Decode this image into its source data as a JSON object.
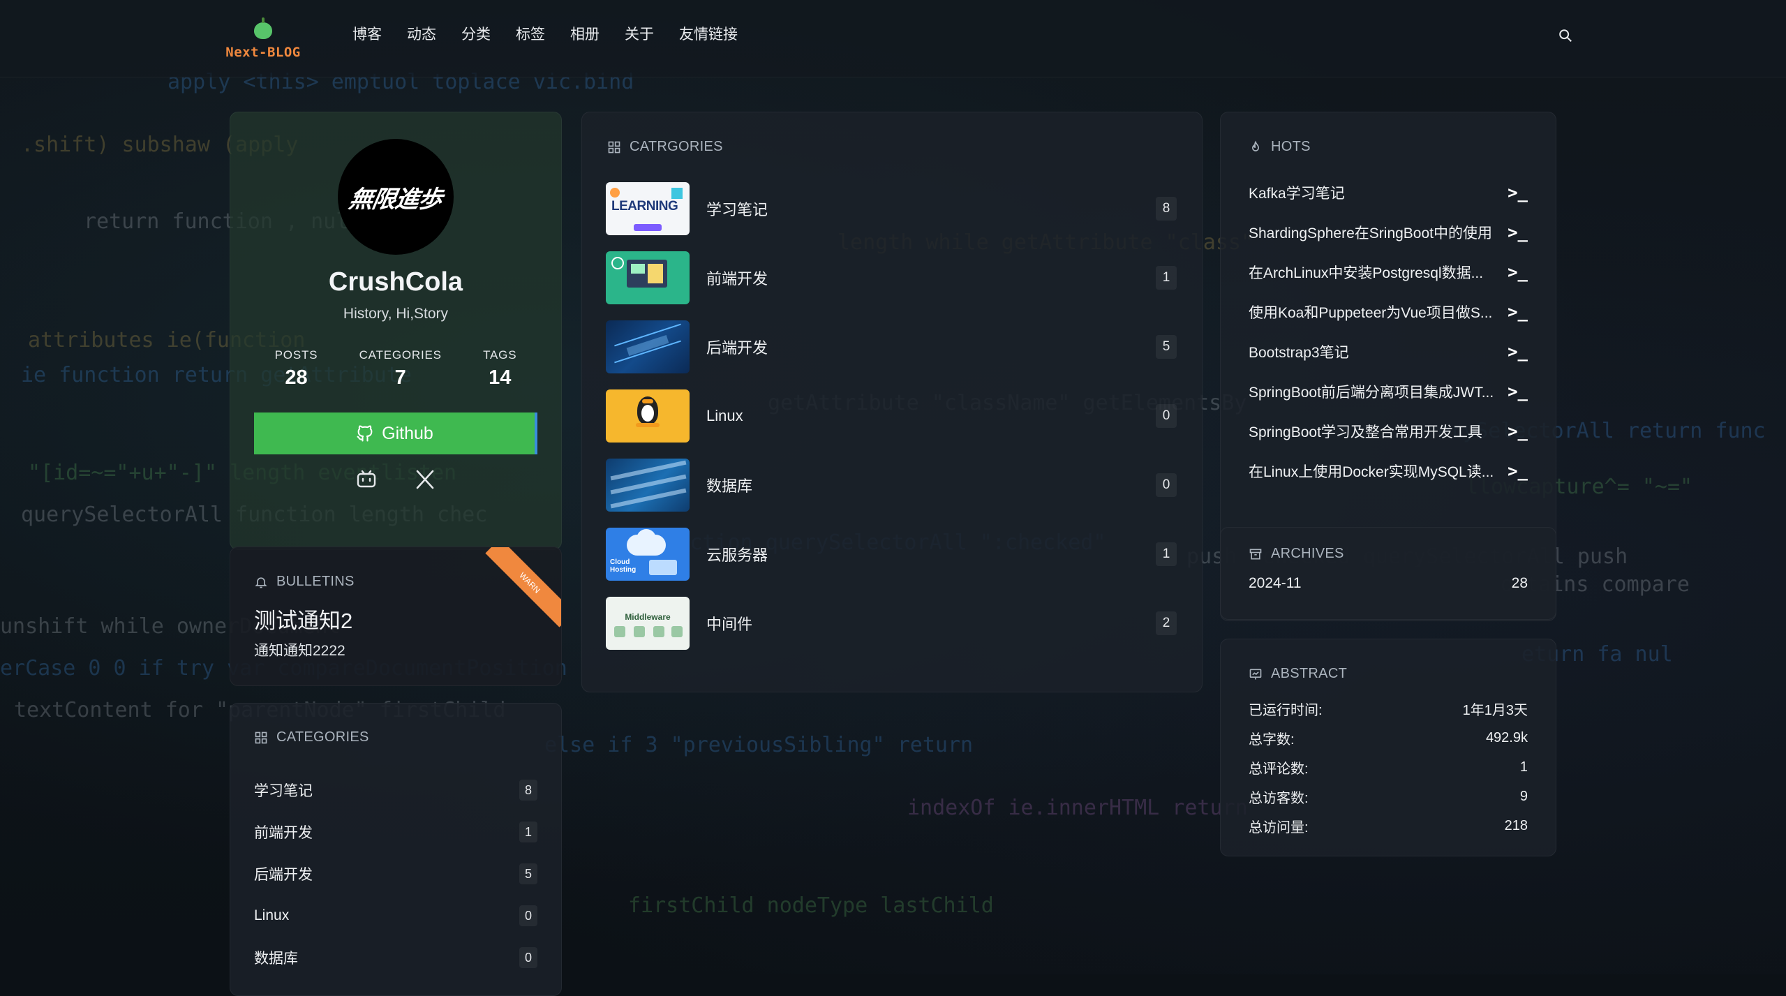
{
  "header": {
    "logo_text": "Next-BLOG",
    "nav": [
      "博客",
      "动态",
      "分类",
      "标签",
      "相册",
      "关于",
      "友情链接"
    ]
  },
  "profile": {
    "avatar_text": "無限進歩",
    "name": "CrushCola",
    "motto": "History, Hi,Story",
    "stats": [
      {
        "label": "POSTS",
        "value": "28"
      },
      {
        "label": "CATEGORIES",
        "value": "7"
      },
      {
        "label": "TAGS",
        "value": "14"
      }
    ],
    "github_label": "Github",
    "social_icons": [
      "bilibili-icon",
      "x-icon"
    ]
  },
  "bulletins": {
    "title": "BULLETINS",
    "headline": "测试通知2",
    "text": "通知通知2222",
    "ribbon": "WARN"
  },
  "left_categories": {
    "title": "CATEGORIES",
    "items": [
      {
        "name": "学习笔记",
        "count": "8"
      },
      {
        "name": "前端开发",
        "count": "1"
      },
      {
        "name": "后端开发",
        "count": "5"
      },
      {
        "name": "Linux",
        "count": "0"
      },
      {
        "name": "数据库",
        "count": "0"
      }
    ]
  },
  "main_categories": {
    "title": "CATRGORIES",
    "items": [
      {
        "name": "学习笔记",
        "count": "8",
        "thumb": "learning-thumb"
      },
      {
        "name": "前端开发",
        "count": "1",
        "thumb": "frontend-thumb"
      },
      {
        "name": "后端开发",
        "count": "5",
        "thumb": "backend-thumb"
      },
      {
        "name": "Linux",
        "count": "0",
        "thumb": "linux-thumb"
      },
      {
        "name": "数据库",
        "count": "0",
        "thumb": "database-thumb"
      },
      {
        "name": "云服务器",
        "count": "1",
        "thumb": "cloud-thumb"
      },
      {
        "name": "中间件",
        "count": "2",
        "thumb": "middleware-thumb"
      }
    ],
    "thumb_text": {
      "learning": "LEARNING",
      "cloud": "Cloud Hosting",
      "middleware": "Middleware"
    }
  },
  "hots": {
    "title": "HOTS",
    "items": [
      "Kafka学习笔记",
      "ShardingSphere在SringBoot中的使用",
      "在ArchLinux中安装Postgresql数据...",
      "使用Koa和Puppeteer为Vue项目做S...",
      "Bootstrap3笔记",
      "SpringBoot前后端分离项目集成JWT...",
      "SpringBoot学习及整合常用开发工具",
      "在Linux上使用Docker实现MySQL读..."
    ],
    "terminal_glyph": ">_"
  },
  "archives": {
    "title": "ARCHIVES",
    "month": "2024-11",
    "count": "28"
  },
  "abstract": {
    "title": "ABSTRACT",
    "rows": [
      {
        "label": "已运行时间:",
        "value": "1年1月3天"
      },
      {
        "label": "总字数:",
        "value": "492.9k"
      },
      {
        "label": "总评论数:",
        "value": "1"
      },
      {
        "label": "总访客数:",
        "value": "9"
      },
      {
        "label": "总访问量:",
        "value": "218"
      }
    ]
  },
  "colors": {
    "accent_green": "#3fb950",
    "logo_orange": "#f0883e",
    "card_bg": "#1b2129"
  }
}
